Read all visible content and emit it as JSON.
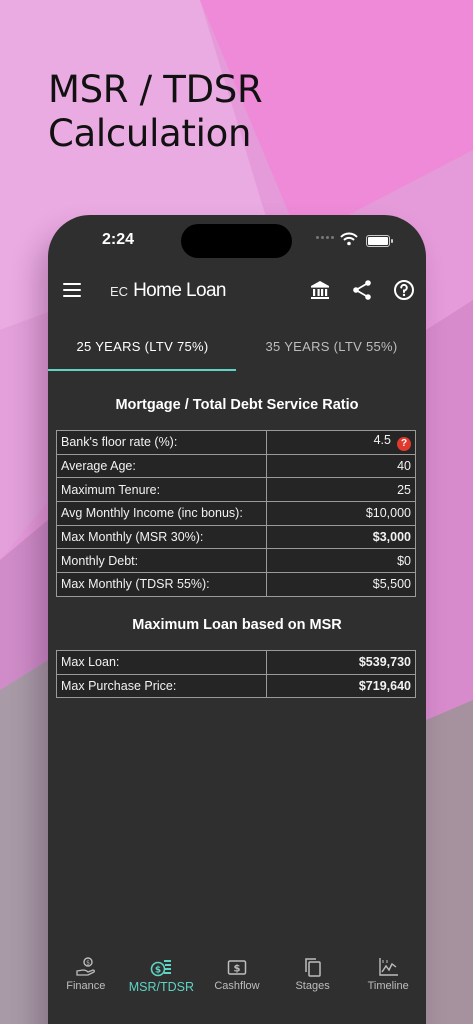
{
  "headline": "MSR / TDSR\nCalculation",
  "status_bar": {
    "time": "2:24"
  },
  "app_bar": {
    "brand_prefix": "EC",
    "brand_name": "Home Loan",
    "actions": [
      "bank-icon",
      "share-icon",
      "help-icon"
    ]
  },
  "tabs": [
    {
      "label": "25 YEARS (LTV 75%)",
      "active": true
    },
    {
      "label": "35 YEARS (LTV 55%)",
      "active": false
    }
  ],
  "section1_title": "Mortgage / Total Debt Service Ratio",
  "ratio_rows": [
    {
      "label": "Bank's floor rate (%):",
      "value": "4.5",
      "help": "?"
    },
    {
      "label": "Average Age:",
      "value": "40"
    },
    {
      "label": "Maximum Tenure:",
      "value": "25"
    },
    {
      "label": "Avg Monthly Income (inc bonus):",
      "value": "$10,000"
    },
    {
      "label": "Max Monthly (MSR 30%):",
      "value": "$3,000"
    },
    {
      "label": "Monthly Debt:",
      "value": "$0"
    },
    {
      "label": "Max Monthly (TDSR 55%):",
      "value": "$5,500"
    }
  ],
  "section2_title": "Maximum Loan based on MSR",
  "loan_rows": [
    {
      "label": "Max Loan:",
      "value": "$539,730"
    },
    {
      "label": "Max Purchase Price:",
      "value": "$719,640"
    }
  ],
  "bottom_nav": [
    {
      "label": "Finance",
      "icon": "money-hand-icon",
      "active": false
    },
    {
      "label": "MSR/TDSR",
      "icon": "coins-icon",
      "active": true
    },
    {
      "label": "Cashflow",
      "icon": "dollar-note-icon",
      "active": false
    },
    {
      "label": "Stages",
      "icon": "copy-pages-icon",
      "active": false
    },
    {
      "label": "Timeline",
      "icon": "line-chart-icon",
      "active": false
    }
  ],
  "colors": {
    "accent": "#5fd3c4",
    "app_background": "#2f2f2f",
    "help_badge": "#e03a2f",
    "page_background": "#e59ad9"
  }
}
